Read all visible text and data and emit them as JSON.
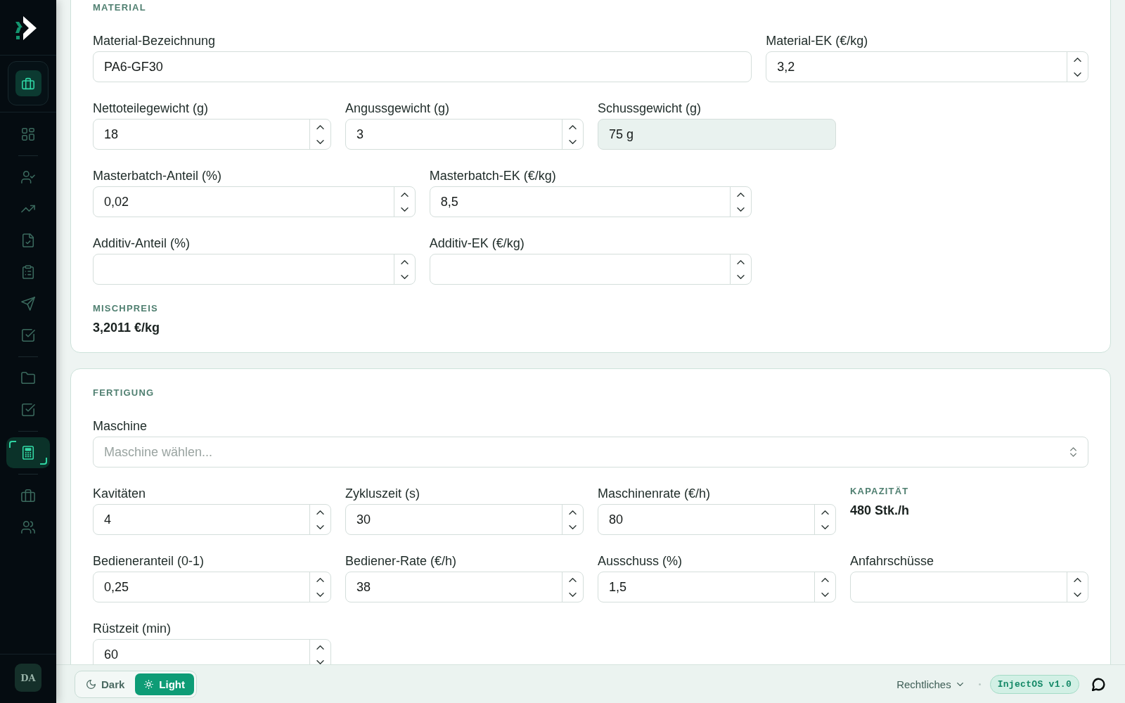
{
  "sidebar": {
    "nav_groups": [
      [
        {
          "selected": false
        }
      ],
      [
        {
          "selected": false
        },
        {
          "selected": false
        },
        {
          "selected": false
        },
        {
          "selected": false
        },
        {
          "selected": false
        },
        {
          "selected": false
        }
      ],
      [
        {
          "selected": false
        },
        {
          "selected": false
        }
      ],
      [
        {
          "selected": true
        }
      ],
      [
        {
          "selected": false
        },
        {
          "selected": false
        }
      ]
    ],
    "avatar_initials": "DA"
  },
  "sections": [
    {
      "heading": "MATERIAL",
      "rows": [
        [
          {
            "kind": "text",
            "label": "Material-Bezeichnung",
            "value": "PA6-GF30"
          },
          {
            "kind": "number",
            "label": "Material-EK (€/kg)",
            "value": "3,2"
          }
        ],
        [
          {
            "kind": "number",
            "label": "Nettoteilegewicht (g)",
            "value": "18"
          },
          {
            "kind": "number",
            "label": "Angussgewicht (g)",
            "value": "3"
          },
          {
            "kind": "computed",
            "label": "Schussgewicht (g)",
            "value": "75 g"
          }
        ],
        [
          {
            "kind": "number",
            "label": "Masterbatch-Anteil (%)",
            "value": "0,02"
          },
          {
            "kind": "number",
            "label": "Masterbatch-EK (€/kg)",
            "value": "8,5"
          }
        ],
        [
          {
            "kind": "number",
            "label": "Additiv-Anteil (%)"
          },
          {
            "kind": "number",
            "label": "Additiv-EK (€/kg)"
          }
        ],
        [
          {
            "kind": "stat",
            "label": "MISCHPREIS",
            "value": "3,2011 €/kg"
          }
        ]
      ]
    },
    {
      "heading": "FERTIGUNG",
      "rows": [
        [
          {
            "kind": "select",
            "label": "Maschine",
            "placeholder": "Maschine wählen..."
          }
        ],
        [
          {
            "kind": "number",
            "label": "Kavitäten",
            "value": "4"
          },
          {
            "kind": "number",
            "label": "Zykluszeit (s)",
            "value": "30"
          },
          {
            "kind": "number",
            "label": "Maschinenrate (€/h)",
            "value": "80"
          },
          {
            "kind": "stat",
            "label": "KAPAZITÄT",
            "value": "480 Stk./h"
          }
        ],
        [
          {
            "kind": "number",
            "label": "Bedieneranteil (0-1)",
            "value": "0,25"
          },
          {
            "kind": "number",
            "label": "Bediener-Rate (€/h)",
            "value": "38"
          },
          {
            "kind": "number",
            "label": "Ausschuss (%)",
            "value": "1,5"
          },
          {
            "kind": "number",
            "label": "Anfahrschüsse"
          }
        ],
        [
          {
            "kind": "number",
            "label": "Rüstzeit (min)",
            "value": "60"
          }
        ]
      ]
    }
  ],
  "footer": {
    "theme_options": [
      {
        "label": "Dark",
        "selected": false
      },
      {
        "label": "Light",
        "selected": true
      }
    ],
    "legal_menu": "Rechtliches",
    "version_badge": "InjectOS v1.0"
  }
}
